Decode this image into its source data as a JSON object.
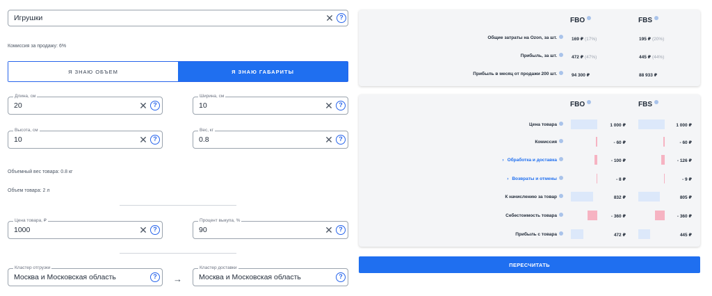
{
  "category": {
    "value": "Игрушки"
  },
  "commission_note": "Комиссия за продажу: 6%",
  "toggle": {
    "volume_label": "Я знаю объем",
    "dims_label": "Я знаю габариты"
  },
  "length": {
    "label": "Длина, см",
    "value": "20"
  },
  "width": {
    "label": "Ширина, см",
    "value": "10"
  },
  "height": {
    "label": "Высота, см",
    "value": "10"
  },
  "weight": {
    "label": "Вес, кг",
    "value": "0.8"
  },
  "volumetric_weight_note": "Объемный вес товара: 0.8 кг",
  "volume_note": "Объем товара: 2 л",
  "price": {
    "label": "Цена товара, ₽",
    "value": "1000"
  },
  "buyout": {
    "label": "Процент выкупа, %",
    "value": "90"
  },
  "ship_cluster": {
    "label": "Кластер отгрузки",
    "value": "Москва и Московская область"
  },
  "delivery_cluster": {
    "label": "Кластер доставки",
    "value": "Москва и Московская область"
  },
  "summary": {
    "col_fbo": "FBO",
    "col_fbs": "FBS",
    "rows": [
      {
        "label": "Общие затраты на Ozon, за шт.",
        "fbo": "169 ₽",
        "fbo_pct": "(17%)",
        "fbs": "195 ₽",
        "fbs_pct": "(20%)"
      },
      {
        "label": "Прибыль, за шт.",
        "fbo": "472 ₽",
        "fbo_pct": "(47%)",
        "fbs": "445 ₽",
        "fbs_pct": "(44%)"
      },
      {
        "label": "Прибыль в месяц от продажи 200 шт.",
        "fbo": "94 300 ₽",
        "fbo_pct": "",
        "fbs": "88 933 ₽",
        "fbs_pct": ""
      }
    ]
  },
  "breakdown": {
    "col_fbo": "FBO",
    "col_fbs": "FBS",
    "rows": [
      {
        "label": "Цена товара",
        "fbo": "1 000 ₽",
        "fbs": "1 000 ₽",
        "fbo_share": 1.0,
        "fbs_share": 1.0,
        "sign": "pos",
        "expandable": false
      },
      {
        "label": "Комиссия",
        "fbo": "- 60 ₽",
        "fbs": "- 60 ₽",
        "fbo_share": 0.06,
        "fbs_share": 0.06,
        "sign": "neg",
        "expandable": false
      },
      {
        "label": "Обработка и доставка",
        "fbo": "- 100 ₽",
        "fbs": "- 126 ₽",
        "fbo_share": 0.1,
        "fbs_share": 0.126,
        "sign": "neg",
        "expandable": true
      },
      {
        "label": "Возвраты и отмены",
        "fbo": "- 8 ₽",
        "fbs": "- 9 ₽",
        "fbo_share": 0.008,
        "fbs_share": 0.009,
        "sign": "neg",
        "expandable": true
      },
      {
        "label": "К начислению за товар",
        "fbo": "832 ₽",
        "fbs": "805 ₽",
        "fbo_share": 0.832,
        "fbs_share": 0.805,
        "sign": "pos",
        "expandable": false
      },
      {
        "label": "Себестоимость товара",
        "fbo": "- 360 ₽",
        "fbs": "- 360 ₽",
        "fbo_share": 0.36,
        "fbs_share": 0.36,
        "sign": "neg",
        "expandable": false
      },
      {
        "label": "Прибыль с товара",
        "fbo": "472 ₽",
        "fbs": "445 ₽",
        "fbo_share": 0.472,
        "fbs_share": 0.445,
        "sign": "pos",
        "expandable": false
      }
    ]
  },
  "recalc_label": "Пересчитать",
  "colors": {
    "accent": "#1f6ff0",
    "pos_bar": "#dce8fa",
    "neg_bar": "#f6b3c2"
  }
}
